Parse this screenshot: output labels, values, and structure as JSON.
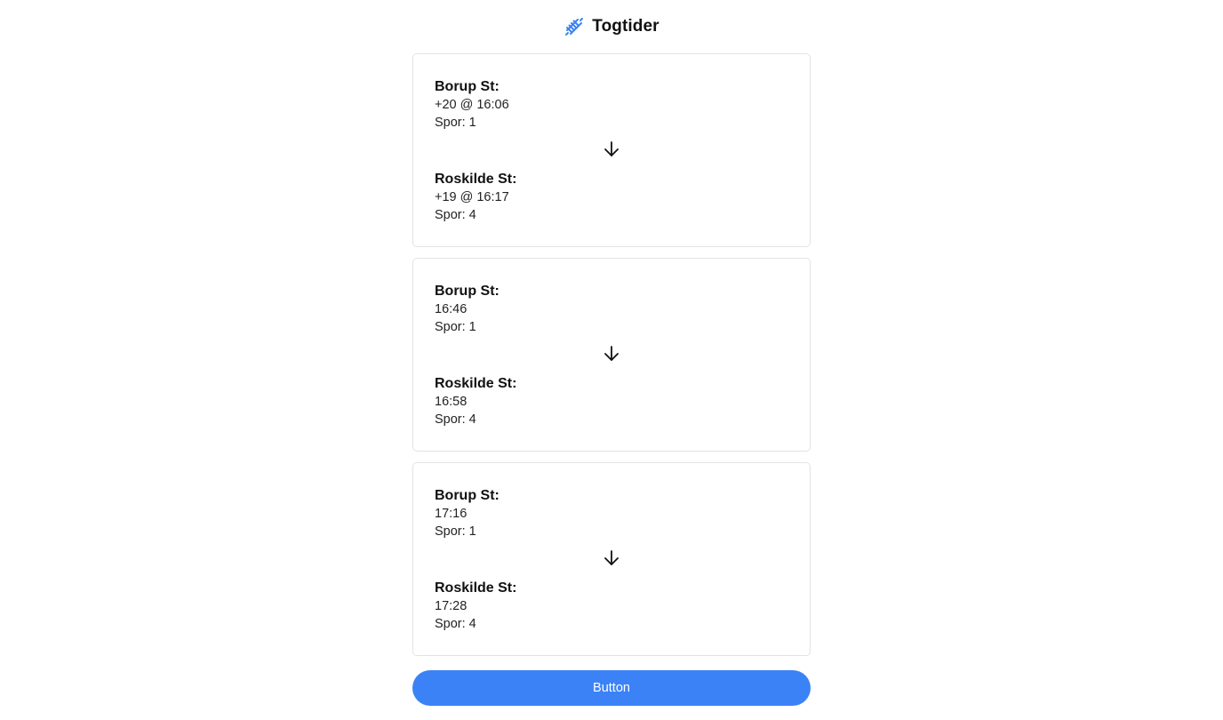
{
  "header": {
    "icon": "railway-track-icon",
    "title": "Togtider",
    "accent_color": "#3b82f6"
  },
  "departures": [
    {
      "from": {
        "station": "Borup St:",
        "time": "+20 @ 16:06",
        "track": "Spor: 1"
      },
      "to": {
        "station": "Roskilde St:",
        "time": "+19 @ 16:17",
        "track": "Spor: 4"
      }
    },
    {
      "from": {
        "station": "Borup St:",
        "time": "16:46",
        "track": "Spor: 1"
      },
      "to": {
        "station": "Roskilde St:",
        "time": "16:58",
        "track": "Spor: 4"
      }
    },
    {
      "from": {
        "station": "Borup St:",
        "time": "17:16",
        "track": "Spor: 1"
      },
      "to": {
        "station": "Roskilde St:",
        "time": "17:28",
        "track": "Spor: 4"
      }
    }
  ],
  "arrow_icon": "arrow-down-icon",
  "button": {
    "label": "Button"
  }
}
